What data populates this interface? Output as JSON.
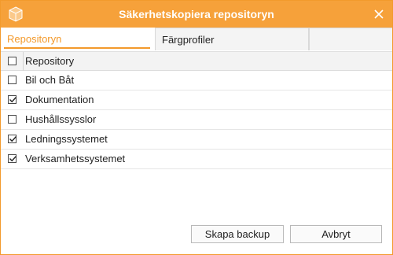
{
  "window": {
    "title": "Säkerhetskopiera repositoryn",
    "accent_color": "#f6a13a",
    "app_icon": "cube-icon",
    "close_icon": "close-icon"
  },
  "tabs": [
    {
      "label": "Repositoryn",
      "active": true
    },
    {
      "label": "Färgprofiler",
      "active": false
    }
  ],
  "table": {
    "header": {
      "label": "Repository",
      "checked": false
    },
    "rows": [
      {
        "label": "Bil och Båt",
        "checked": false
      },
      {
        "label": "Dokumentation",
        "checked": true
      },
      {
        "label": "Hushållssysslor",
        "checked": false
      },
      {
        "label": "Ledningssystemet",
        "checked": true
      },
      {
        "label": "Verksamhetssystemet",
        "checked": true
      }
    ]
  },
  "buttons": {
    "backup": "Skapa backup",
    "cancel": "Avbryt"
  }
}
